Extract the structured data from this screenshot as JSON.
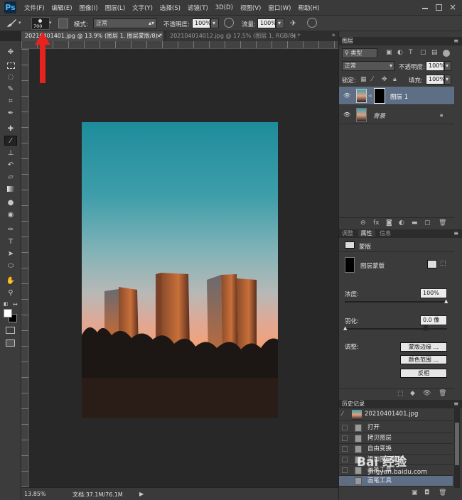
{
  "app": {
    "logo": "Ps"
  },
  "menu": [
    "文件(F)",
    "编辑(E)",
    "图像(I)",
    "图层(L)",
    "文字(Y)",
    "选择(S)",
    "滤镜(T)",
    "3D(D)",
    "视图(V)",
    "窗口(W)",
    "帮助(H)"
  ],
  "options": {
    "brush_size": "700",
    "mode_label": "模式:",
    "mode_value": "正常",
    "opacity_label": "不透明度:",
    "opacity_value": "100%",
    "flow_label": "流量:",
    "flow_value": "100%"
  },
  "doc_tabs": [
    {
      "label": "20210401401.jpg @ 13.9% (图层 1, 图层蒙版/8) *",
      "active": true,
      "close": "×"
    },
    {
      "label": "202104014012.jpg @ 17.5% (图层 1, RGB/8) *",
      "active": false,
      "close": "×"
    }
  ],
  "status": {
    "zoom": "13.85%",
    "doc": "文档:37.1M/76.1M"
  },
  "layers_panel": {
    "title": "图层",
    "kind": "类型",
    "blend": "正常",
    "opacity_label": "不透明度:",
    "opacity_value": "100%",
    "lock_label": "锁定:",
    "fill_label": "填充:",
    "fill_value": "100%",
    "layers": [
      {
        "name": "图层 1",
        "selected": true
      },
      {
        "name": "背景",
        "locked": true
      }
    ]
  },
  "props_panel": {
    "tabs": [
      "调整",
      "属性",
      "信息"
    ],
    "section": "蒙版",
    "mask_label": "图层蒙版",
    "density_label": "浓度:",
    "density_value": "100%",
    "feather_label": "羽化:",
    "feather_value": "0.0 像素",
    "adjust_label": "调整:",
    "buttons": [
      "蒙版边缘 ...",
      "颜色范围 ...",
      "反相"
    ]
  },
  "history_panel": {
    "title": "历史记录",
    "snapshot": "20210401401.jpg",
    "items": [
      "打开",
      "拷贝图层",
      "自由变换",
      "添加图层蒙版",
      "画笔工具",
      "画笔工具"
    ]
  },
  "watermark": {
    "text": "Bai 经验",
    "sub": "jingyan.baidu.com"
  },
  "colors": {
    "arrow": "#e8231e",
    "panel_bg": "#3b3b3b",
    "selected_layer": "#5e6e85"
  }
}
